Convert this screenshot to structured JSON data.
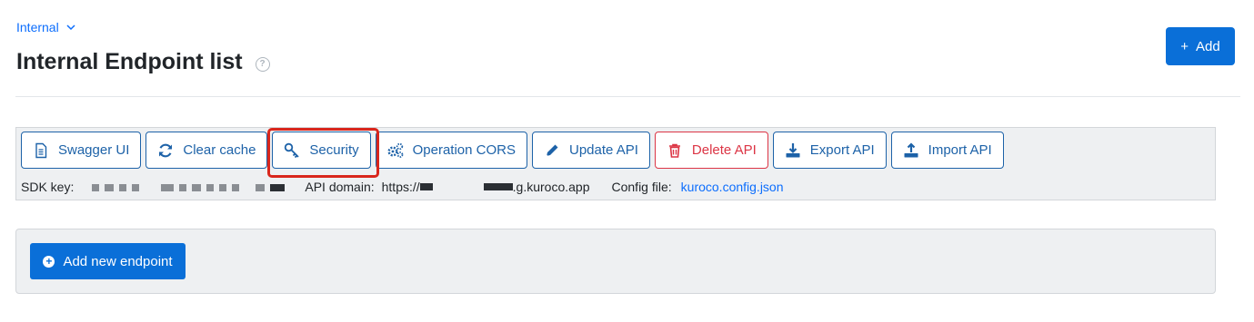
{
  "breadcrumb": {
    "label": "Internal"
  },
  "page": {
    "title": "Internal Endpoint list",
    "help_symbol": "?"
  },
  "header": {
    "add_label": "Add",
    "add_symbol": "+"
  },
  "toolbar": {
    "buttons": [
      {
        "label": "Swagger UI",
        "icon": "document-icon"
      },
      {
        "label": "Clear cache",
        "icon": "refresh-icon"
      },
      {
        "label": "Security",
        "icon": "key-icon"
      },
      {
        "label": "Operation CORS",
        "icon": "gears-icon"
      },
      {
        "label": "Update API",
        "icon": "pencil-icon"
      },
      {
        "label": "Delete API",
        "icon": "trash-icon"
      },
      {
        "label": "Export API",
        "icon": "download-icon"
      },
      {
        "label": "Import API",
        "icon": "upload-icon"
      }
    ],
    "sdk_key_label": "SDK key:",
    "api_domain_label": "API domain:",
    "api_domain_prefix": "https://",
    "api_domain_suffix": ".g.kuroco.app",
    "config_file_label": "Config file:",
    "config_file_link": "kuroco.config.json"
  },
  "endpoints": {
    "add_label": "Add new endpoint"
  },
  "colors": {
    "primary": "#0a6fd8",
    "outline": "#1d62a8",
    "danger": "#dc3545",
    "highlight": "#d9261c"
  }
}
